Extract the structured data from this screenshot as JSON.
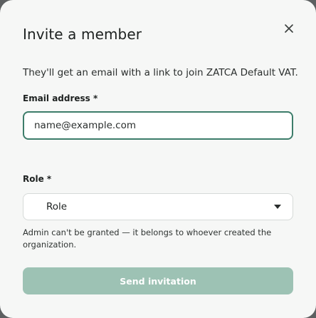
{
  "dialog": {
    "title": "Invite a member",
    "description": "They'll get an email with a link to join ZATCA Default VAT.",
    "close_icon": "close-icon"
  },
  "email": {
    "label": "Email address *",
    "placeholder": "name@example.com",
    "value": ""
  },
  "role": {
    "label": "Role *",
    "selected": "Role",
    "dropdown_icon": "chevron-down-icon"
  },
  "hint": "Admin can't be granted — it belongs to whoever created the organization.",
  "actions": {
    "send_label": "Send invitation"
  },
  "colors": {
    "focus_border": "#3d7d6a",
    "button_bg": "#9dc2b4",
    "modal_bg": "#f6f7f6"
  }
}
